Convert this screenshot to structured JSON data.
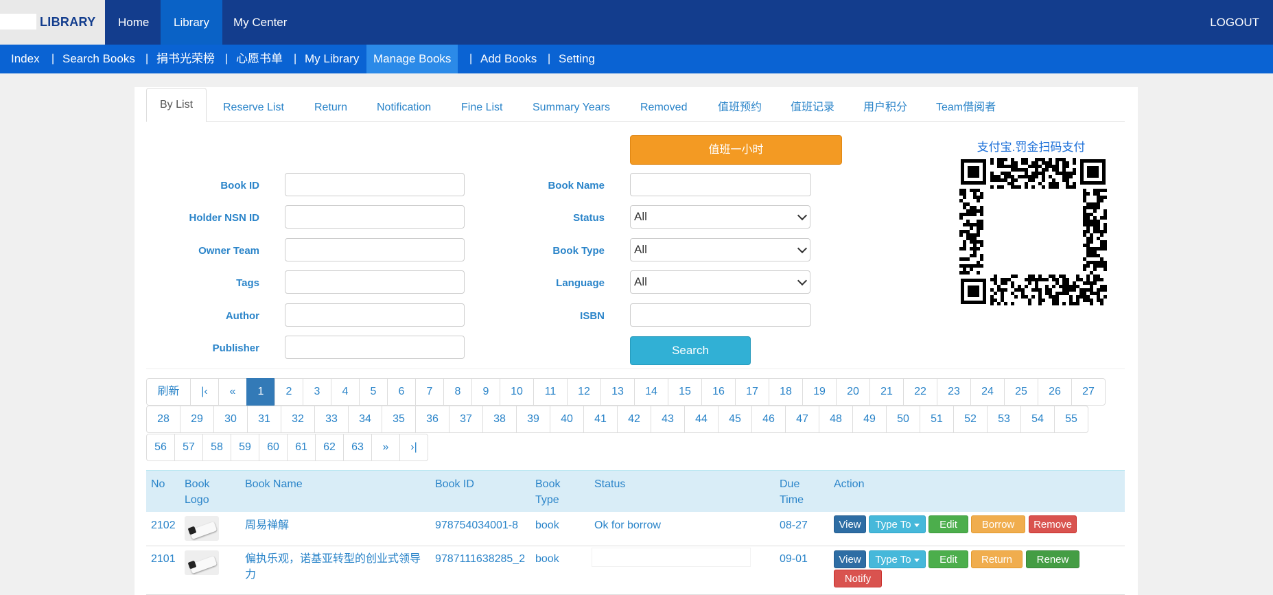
{
  "brand": {
    "name": "LIBRARY"
  },
  "topnav": {
    "home": "Home",
    "library": "Library",
    "my_center": "My Center",
    "logout": "LOGOUT"
  },
  "subnav": {
    "index": "Index",
    "search_books": "Search Books",
    "donation_honor": "捐书光荣榜",
    "wishlist": "心愿书单",
    "my_library": "My Library",
    "manage_books": "Manage Books",
    "add_books": "Add Books",
    "setting": "Setting",
    "separator": "|"
  },
  "tabs": {
    "by_list": "By List",
    "reserve_list": "Reserve List",
    "return": "Return",
    "notification": "Notification",
    "fine_list": "Fine List",
    "summary_years": "Summary Years",
    "removed": "Removed",
    "duty_reservation": "值班预约",
    "duty_record": "值班记录",
    "user_points": "用户积分",
    "team_borrower": "Team借阅者"
  },
  "form": {
    "duty_button": "值班一小时",
    "book_id_label": "Book ID",
    "book_name_label": "Book Name",
    "holder_label": "Holder NSN ID",
    "status_label": "Status",
    "status_value": "All",
    "owner_team_label": "Owner Team",
    "book_type_label": "Book Type",
    "book_type_value": "All",
    "tags_label": "Tags",
    "language_label": "Language",
    "language_value": "All",
    "author_label": "Author",
    "isbn_label": "ISBN",
    "publisher_label": "Publisher",
    "search_button": "Search"
  },
  "payment": {
    "caption": "支付宝.罚金扫码支付"
  },
  "pagination": {
    "refresh": "刷新",
    "first": "|‹",
    "prev": "«",
    "next": "»",
    "last": "›|",
    "current_page": 1,
    "row1": [
      "1",
      "2",
      "3",
      "4",
      "5",
      "6",
      "7",
      "8",
      "9",
      "10",
      "11",
      "12",
      "13",
      "14",
      "15",
      "16",
      "17",
      "18",
      "19",
      "20",
      "21",
      "22",
      "23",
      "24",
      "25",
      "26",
      "27"
    ],
    "row2": [
      "28",
      "29",
      "30",
      "31",
      "32",
      "33",
      "34",
      "35",
      "36",
      "37",
      "38",
      "39",
      "40",
      "41",
      "42",
      "43",
      "44",
      "45",
      "46",
      "47",
      "48",
      "49",
      "50",
      "51",
      "52",
      "53",
      "54",
      "55"
    ],
    "row3": [
      "56",
      "57",
      "58",
      "59",
      "60",
      "61",
      "62",
      "63"
    ]
  },
  "table": {
    "headers": {
      "no": "No",
      "logo_1": "Book",
      "logo_2": "Logo",
      "name": "Book Name",
      "id": "Book ID",
      "type_1": "Book",
      "type_2": "Type",
      "status": "Status",
      "due_1": "Due",
      "due_2": "Time",
      "action": "Action"
    },
    "rows": [
      {
        "no": "2102",
        "name": "周易禅解",
        "name_line2": "",
        "id": "978754034001-8",
        "type": "book",
        "status": "Ok for borrow",
        "due": "08-27",
        "actions": {
          "view": "View",
          "type_to": "Type To",
          "edit": "Edit",
          "a4": "Borrow",
          "a5": "Remove"
        }
      },
      {
        "no": "2101",
        "name": "偏执乐观，诺基亚转型的创业式领导",
        "name_line2": "力",
        "id": "9787111638285_2",
        "type": "book",
        "status": "",
        "due": "09-01",
        "actions": {
          "view": "View",
          "type_to": "Type To",
          "edit": "Edit",
          "a4": "Return",
          "a5": "Renew",
          "a6": "Notify"
        }
      }
    ]
  }
}
